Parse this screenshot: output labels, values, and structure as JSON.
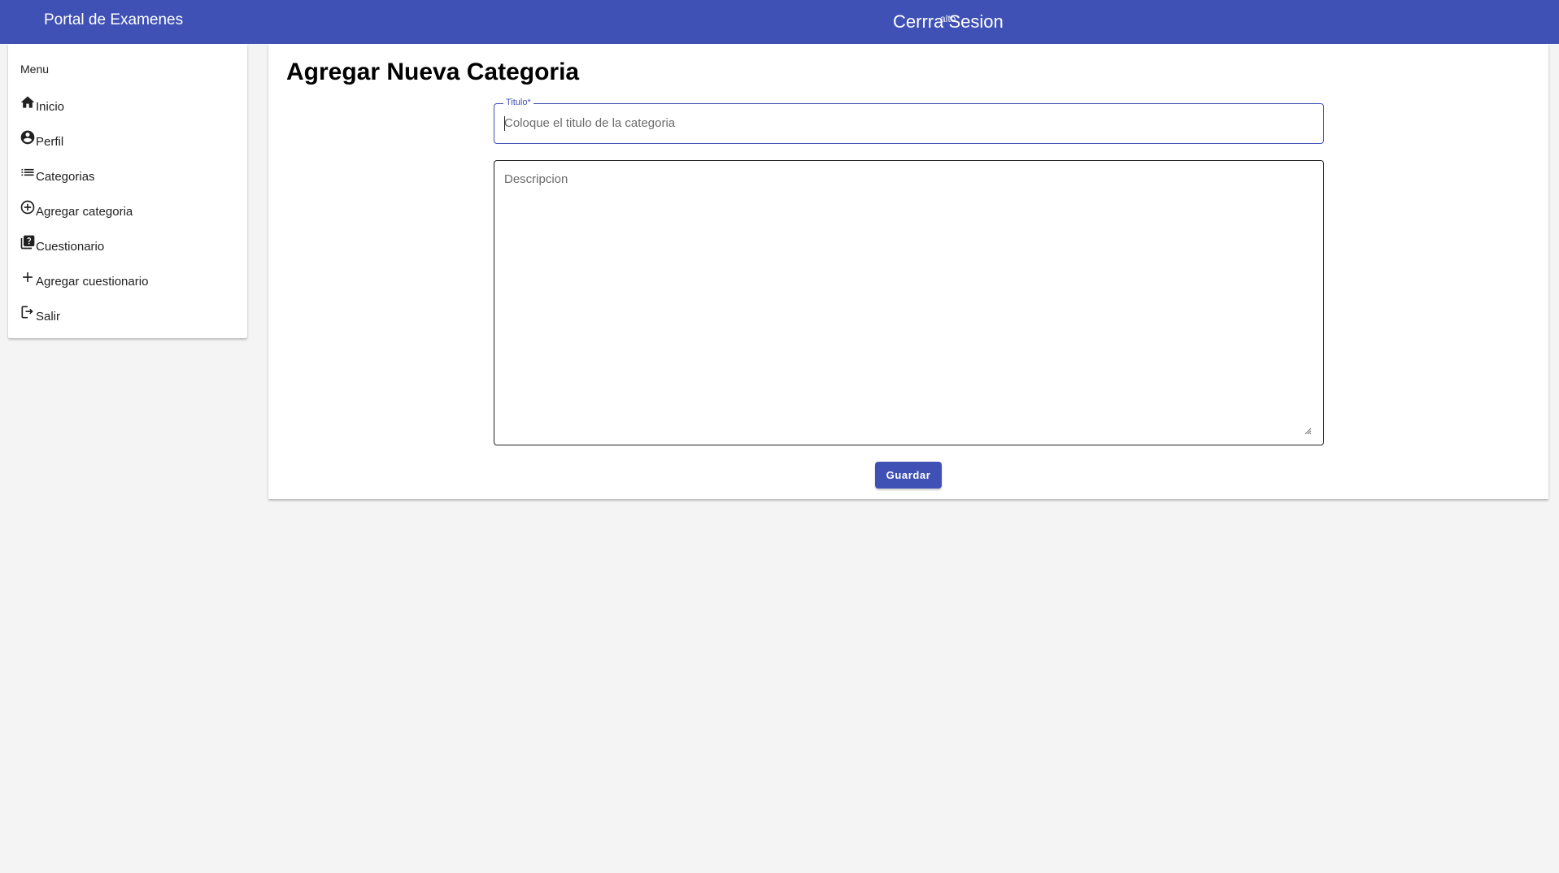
{
  "header": {
    "brand": "Portal de Examenes",
    "logout_label": "Cerrra Sesion",
    "logout_overlay": "alto"
  },
  "sidebar": {
    "heading": "Menu",
    "items": [
      {
        "label": "Inicio",
        "icon": "home-icon"
      },
      {
        "label": "Perfil",
        "icon": "account-circle-icon"
      },
      {
        "label": "Categorias",
        "icon": "list-icon"
      },
      {
        "label": "Agregar categoria",
        "icon": "add-circle-outline-icon"
      },
      {
        "label": "Cuestionario",
        "icon": "quiz-icon"
      },
      {
        "label": "Agregar cuestionario",
        "icon": "plus-icon"
      },
      {
        "label": "Salir",
        "icon": "logout-icon"
      }
    ]
  },
  "main": {
    "title": "Agregar Nueva Categoria",
    "title_field": {
      "label": "Titulo*",
      "placeholder": "Coloque el titulo de la categoria",
      "value": ""
    },
    "description_field": {
      "placeholder": "Descripcion",
      "value": ""
    },
    "save_label": "Guardar"
  },
  "colors": {
    "primary": "#3f51b5",
    "background": "#f4f4f4",
    "card": "#ffffff"
  }
}
